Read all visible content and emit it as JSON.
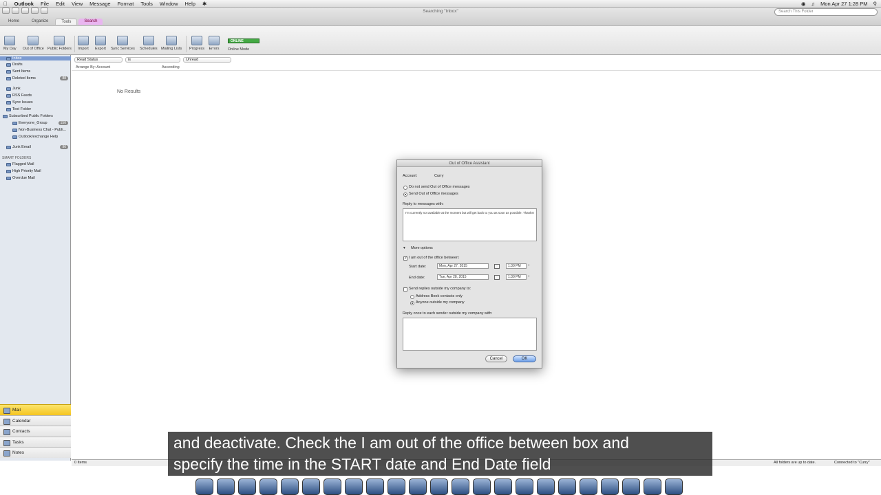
{
  "menubar": {
    "app_name": "Outlook",
    "items": [
      "File",
      "Edit",
      "View",
      "Message",
      "Format",
      "Tools",
      "Window",
      "Help"
    ],
    "datetime": "Mon Apr 27  1:28 PM"
  },
  "window": {
    "title": "Searching \"Inbox\""
  },
  "search": {
    "placeholder": "Search This Folder"
  },
  "tabs": [
    "Home",
    "Organize",
    "Tools",
    "Search"
  ],
  "ribbon": {
    "buttons": [
      "My Day",
      "Out of Office",
      "Public Folders",
      "Import",
      "Export",
      "Sync Services",
      "Schedules",
      "Mailing Lists",
      "Progress",
      "Errors"
    ],
    "online_badge": "ONLINE",
    "online_label": "Online Mode"
  },
  "sidebar": {
    "folders": [
      {
        "label": "Inbox",
        "selected": true
      },
      {
        "label": "Drafts"
      },
      {
        "label": "Sent Items"
      },
      {
        "label": "Deleted Items",
        "badge": "88"
      },
      {
        "label": "Junk"
      },
      {
        "label": "RSS Feeds"
      },
      {
        "label": "Sync Issues"
      },
      {
        "label": "Test Folder"
      },
      {
        "label": "Subscribed Public Folders"
      },
      {
        "label": "Everyone_Group",
        "badge": "150"
      },
      {
        "label": "Non-Business Chat - Publi..."
      },
      {
        "label": "Outlook/exchange Help"
      },
      {
        "label": "Junk Email",
        "badge": "96"
      }
    ],
    "smart_folders_header": "SMART FOLDERS",
    "smart_folders": [
      "Flagged Mail",
      "High Priority Mail",
      "Overdue Mail"
    ]
  },
  "nav": [
    "Mail",
    "Calendar",
    "Contacts",
    "Tasks",
    "Notes"
  ],
  "list": {
    "filters": [
      "Read Status",
      "is",
      "Unread"
    ],
    "arrange_by": "Arrange By: Account",
    "sort_order": "Ascending",
    "no_results": "No Results"
  },
  "status": {
    "items": "0 Items",
    "up_to_date": "All folders are up to date.",
    "connected": "Connected to \"Curry\""
  },
  "dialog": {
    "title": "Out of Office Assistant",
    "account_label": "Account:",
    "account_value": "Curry",
    "radio_off": "Do not send Out of Office messages",
    "radio_on": "Send Out of Office messages",
    "reply_label": "Reply to messages with:",
    "reply_text": "I'm currently not available at the moment but will get back to you as soon as possible. Thanks!",
    "more_options": "More options",
    "between_label": "I am out of the office between:",
    "start_label": "Start date:",
    "start_date": "Mon, Apr 27, 2015",
    "start_time": "1:30 PM",
    "end_label": "End date:",
    "end_date": "Tue, Apr 28, 2015",
    "end_time": "1:30 PM",
    "outside_label": "Send replies outside my company to:",
    "outside_opt1": "Address Book contacts only",
    "outside_opt2": "Anyone outside my company",
    "outside_reply_label": "Reply once to each sender outside my company with:",
    "cancel": "Cancel",
    "ok": "OK"
  },
  "caption": {
    "line1": "and deactivate. Check the I am out of the office between box and",
    "line2": "specify the time in the START date and End Date field"
  },
  "dock_icons": [
    "finder-icon",
    "safari-icon",
    "mail-icon",
    "terminal-icon",
    "preview-icon",
    "activity-monitor-icon",
    "gem-icon",
    "network-icon",
    "system-prefs-icon",
    "app-store-icon",
    "xcode-icon",
    "ios-icon",
    "lagarde-icon",
    "lagarde-icon-2",
    "outlook-icon",
    "itunes-icon",
    "ibooks-icon",
    "quicktime-icon",
    "appstore-icon-2",
    "folder-icon",
    "textedit-icon",
    "downloads-icon",
    "trash-icon"
  ]
}
